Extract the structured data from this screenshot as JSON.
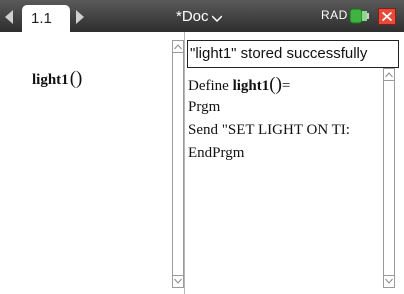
{
  "topbar": {
    "tab_label": "1.1",
    "doc_title": "*Doc",
    "angle_mode": "RAD"
  },
  "left": {
    "func_name": "light1",
    "func_paren": "()"
  },
  "right": {
    "status_message": "\"light1\" stored successfully",
    "lines": [
      {
        "prefix": "Define ",
        "bold": "light1",
        "paren": "()",
        "suffix": "="
      },
      {
        "text": "Prgm"
      },
      {
        "text": "Send \"SET LIGHT ON TI:"
      },
      {
        "text": "EndPrgm"
      }
    ]
  },
  "colors": {
    "topbar": "#3d3d3d",
    "close": "#e84a3a",
    "battery": "#3fb33f"
  }
}
